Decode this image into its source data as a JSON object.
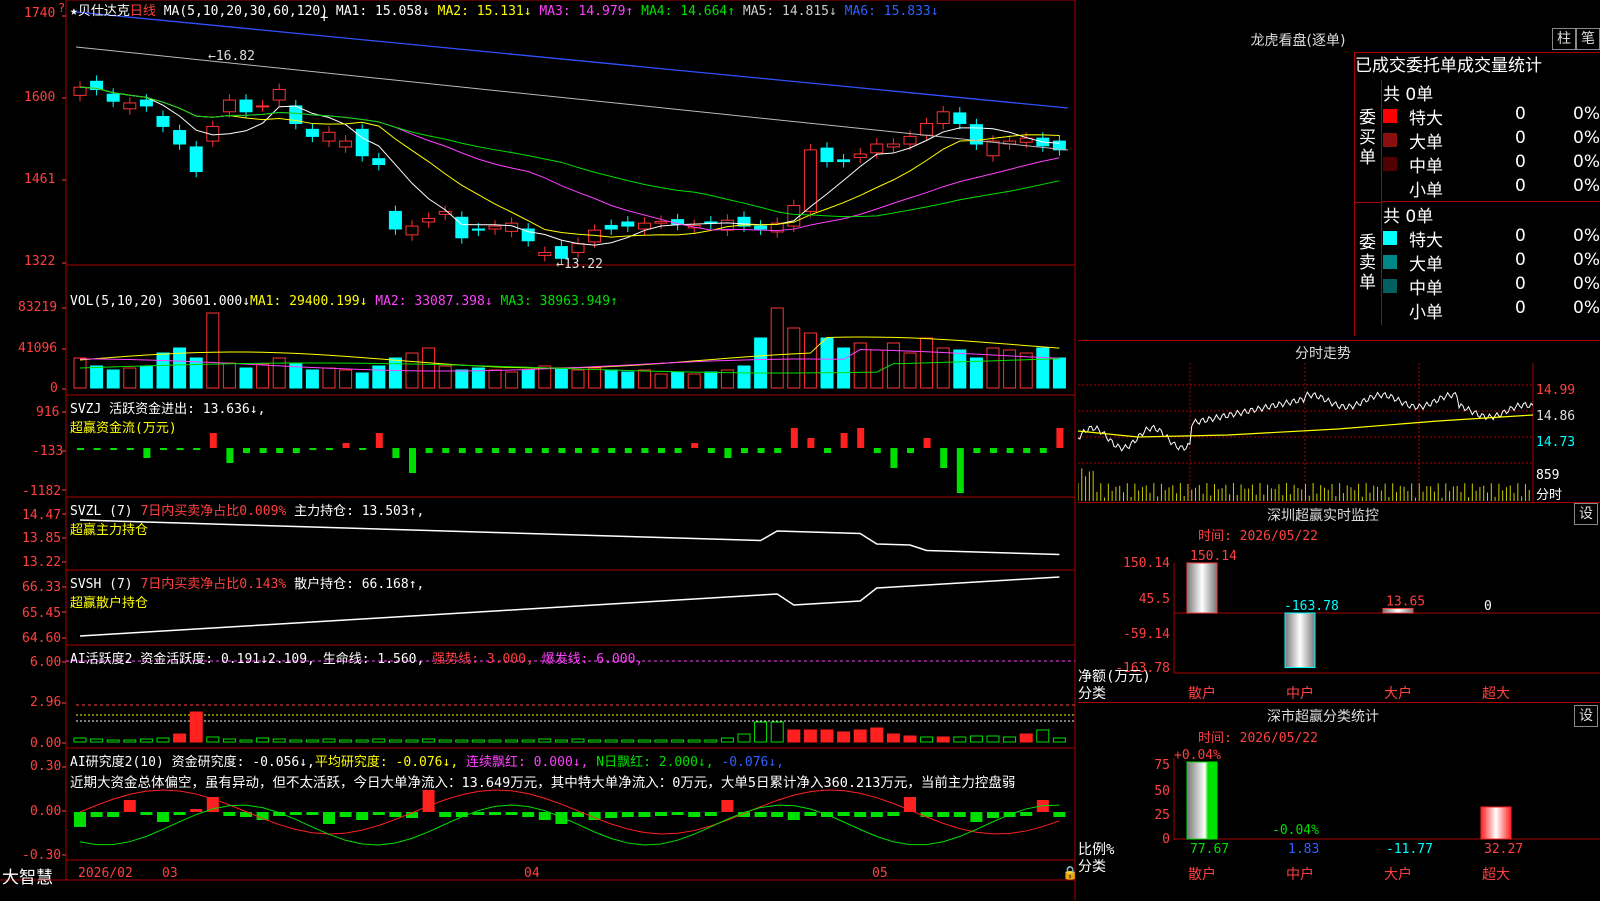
{
  "stock": {
    "star": "★",
    "name": "贝仕达克",
    "period": "日线"
  },
  "price_panel": {
    "ma_params": "MA(5,10,20,30,60,120)",
    "legend": [
      {
        "label": "MA1: 15.058↓",
        "color": "#ffffff"
      },
      {
        "label": "MA2: 15.131↓",
        "color": "#ffff00"
      },
      {
        "label": "MA3: 14.979↑",
        "color": "#ff40ff"
      },
      {
        "label": "MA4: 14.664↑",
        "color": "#00e000"
      },
      {
        "label": "MA5: 14.815↓",
        "color": "#cccccc"
      },
      {
        "label": "MA6: 15.833↓",
        "color": "#3060ff"
      }
    ],
    "y_ticks": [
      "1740",
      "1600",
      "1461",
      "1322"
    ],
    "high_label": "16.82",
    "low_label": "13.22"
  },
  "vol_panel": {
    "title": "VOL(5,10,20)",
    "value": "30601.000↓",
    "ma1": "MA1: 29400.199↓",
    "ma2": "MA2: 33087.398↓",
    "ma3": "MA3: 38963.949↑",
    "y_ticks": [
      "83219",
      "41096",
      "0"
    ]
  },
  "svzj_panel": {
    "title": "SVZJ  活跃资金进出: 13.636↓,",
    "sub": "超赢资金流(万元)",
    "y_ticks": [
      "916",
      "-133",
      "-1182"
    ]
  },
  "svzl_panel": {
    "title": "SVZL (7)",
    "t2": "7日内买卖净占比0.009%",
    "t3": "主力持仓: 13.503↑,",
    "sub": "超赢主力持仓",
    "y_ticks": [
      "14.47",
      "13.85",
      "13.22"
    ]
  },
  "svsh_panel": {
    "title": "SVSH (7)",
    "t2": "7日内买卖净占比0.143%",
    "t3": "散户持仓: 66.168↑,",
    "sub": "超赢散户持仓",
    "y_ticks": [
      "66.33",
      "65.45",
      "64.60"
    ]
  },
  "ai1_panel": {
    "title": "AI活跃度2 资金活跃度: 0.191↓",
    "v2": "2.109,",
    "v3": "生命线: 1.560,",
    "v4": "强势线: 3.000,",
    "v5": "爆发线: 6.000,",
    "y_ticks": [
      "6.00",
      "2.96",
      "0.00"
    ]
  },
  "ai2_panel": {
    "title": "AI研究度2(10) 资金研究度: -0.056↓,",
    "v2": "平均研究度: -0.076↓,",
    "v3": "连续飘红: 0.000↓,",
    "v4": "N日飘红: 2.000↓,",
    "v5": "-0.076↓,",
    "text": "近期大资金总体偏空，虽有异动，但不太活跃，今日大单净流入：13.649万元，其中特大单净流入：0万元，大单5日累计净入360.213万元，当前主力控盘弱",
    "y_ticks": [
      "0.30",
      "0.00",
      "-0.30"
    ]
  },
  "x_axis": {
    "labels": [
      "2026/02",
      "03",
      "04",
      "05"
    ],
    "brand": "大智慧"
  },
  "dragon": {
    "title": "龙虎看盘(逐单)",
    "btn1": "柱",
    "btn2": "笔",
    "header": "已成交委托单成交量统计",
    "buy_side": "委买单",
    "sell_side": "委卖单",
    "buy_total": "共 0单",
    "sell_total": "共 0单",
    "buy_rows": [
      {
        "name": "特大",
        "v": "0",
        "p": "0%",
        "color": "#ff0000"
      },
      {
        "name": "大单",
        "v": "0",
        "p": "0%",
        "color": "#8a1010"
      },
      {
        "name": "中单",
        "v": "0",
        "p": "0%",
        "color": "#500000"
      },
      {
        "name": "小单",
        "v": "0",
        "p": "0%",
        "color": "#000000"
      }
    ],
    "sell_rows": [
      {
        "name": "特大",
        "v": "0",
        "p": "0%",
        "color": "#00ffff"
      },
      {
        "name": "大单",
        "v": "0",
        "p": "0%",
        "color": "#008888"
      },
      {
        "name": "中单",
        "v": "0",
        "p": "0%",
        "color": "#006060"
      },
      {
        "name": "小单",
        "v": "0",
        "p": "0%",
        "color": "#000000"
      }
    ]
  },
  "intraday": {
    "title": "分时走势",
    "prices": [
      "14.99",
      "14.86",
      "14.73"
    ],
    "vol": "859",
    "vol_unit": "分时"
  },
  "sz_monitor": {
    "title": "深圳超赢实时监控",
    "btn": "设",
    "time": "时间: 2026/05/22",
    "y_ticks": [
      "150.14",
      "45.5",
      "-59.14",
      "-163.78"
    ],
    "bars": [
      {
        "cat": "散户",
        "value": 150.14,
        "label": "150.14"
      },
      {
        "cat": "中户",
        "value": -163.78,
        "label": "-163.78"
      },
      {
        "cat": "大户",
        "value": 13.65,
        "label": "13.65"
      },
      {
        "cat": "超大",
        "value": 0,
        "label": "0"
      }
    ],
    "ylabel": "净额(万元)",
    "xlabel": "分类"
  },
  "sz_stats": {
    "title": "深市超赢分类统计",
    "btn": "设",
    "time": "时间: 2026/05/22",
    "y_ticks": [
      "75",
      "50",
      "25",
      "0"
    ],
    "top_labels": [
      "+0.04%",
      "-0.04%"
    ],
    "bars": [
      {
        "cat": "散户",
        "value": 77.67,
        "label": "77.67"
      },
      {
        "cat": "中户",
        "value": 1.83,
        "label": "1.83"
      },
      {
        "cat": "大户",
        "value": -11.77,
        "label": "-11.77"
      },
      {
        "cat": "超大",
        "value": 32.27,
        "label": "32.27"
      }
    ],
    "ylabel": "比例%",
    "xlabel": "分类"
  }
}
